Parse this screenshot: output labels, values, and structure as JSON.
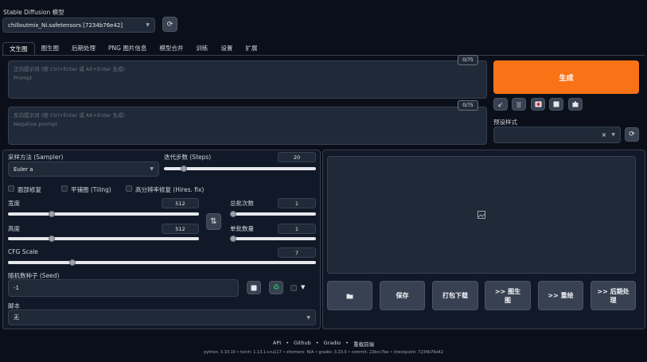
{
  "model": {
    "label": "Stable Diffusion 模型",
    "value": "chilloutmix_Ni.safetensors [7234b76e42]"
  },
  "tabs": [
    "文生图",
    "图生图",
    "后期处理",
    "PNG 图片信息",
    "模型合并",
    "训练",
    "设置",
    "扩展"
  ],
  "prompt": {
    "counter": "0/75",
    "placeholder_cn": "正向提示词 (按 Ctrl+Enter 或 Alt+Enter 生成)",
    "placeholder_en": "Prompt"
  },
  "negative": {
    "counter": "0/75",
    "placeholder_cn": "反向提示词 (按 Ctrl+Enter 或 Alt+Enter 生成)",
    "placeholder_en": "Negative prompt"
  },
  "generate_label": "生成",
  "styles": {
    "label": "预设样式",
    "clear": "×"
  },
  "sampler": {
    "label": "采样方法 (Sampler)",
    "value": "Euler a"
  },
  "steps": {
    "label": "迭代步数 (Steps)",
    "value": "20",
    "fraction": 0.13
  },
  "checkboxes": [
    "面部修复",
    "平铺图 (Tiling)",
    "高分辨率修复 (Hires. fix)"
  ],
  "width": {
    "label": "宽度",
    "value": "512",
    "fraction": 0.23
  },
  "height": {
    "label": "高度",
    "value": "512",
    "fraction": 0.23
  },
  "swap_icon": "⇅",
  "batch_count": {
    "label": "总批次数",
    "value": "1",
    "fraction": 0.0
  },
  "batch_size": {
    "label": "单批数量",
    "value": "1",
    "fraction": 0.0
  },
  "cfg": {
    "label": "CFG Scale",
    "value": "7",
    "fraction": 0.21
  },
  "seed": {
    "label": "随机数种子 (Seed)",
    "value": "-1"
  },
  "script": {
    "label": "脚本",
    "value": "无"
  },
  "output_buttons": [
    "保存",
    "打包下载",
    ">> 图生图",
    ">> 重绘",
    ">> 后期处理"
  ],
  "footer": {
    "links": [
      "API",
      "Github",
      "Gradio",
      "重载前端"
    ],
    "sep": "•",
    "versions": "python: 3.10.10  •  torch: 1.13.1+cu117  •  xformers: N/A  •  gradio: 3.23.0  •  commit: 22bcc7be  •  checkpoint: 7234b76e42"
  },
  "colors": {
    "accent": "#f97316",
    "background": "#0b0f19",
    "panel": "#1f2937"
  }
}
